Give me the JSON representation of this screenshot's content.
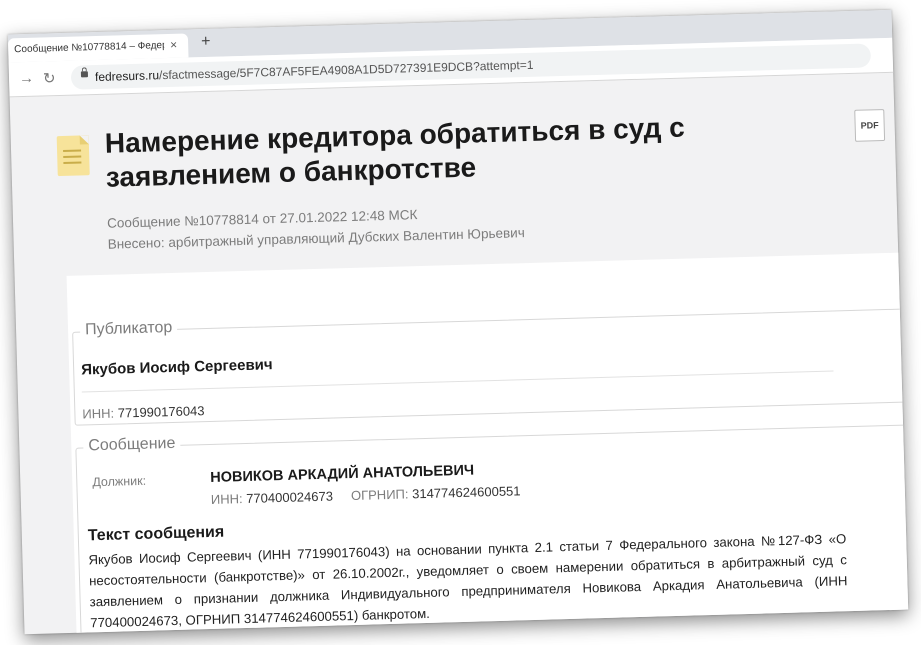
{
  "browser": {
    "tab_title": "Сообщение №10778814 – Федерс",
    "tab_close": "×",
    "new_tab": "+",
    "url_host": "fedresurs.ru",
    "url_path": "/sfactmessage/5F7C87AF5FEA4908A1D5D727391E9DCB?attempt=1",
    "back_icon": "back-arrow-icon",
    "forward_icon": "forward-arrow-icon",
    "reload_icon": "reload-icon"
  },
  "header": {
    "title": "Намерение кредитора обратиться в суд с заявлением о банкротстве",
    "pdf_label": "PDF",
    "meta_line1": "Сообщение №10778814 от 27.01.2022 12:48 МСК",
    "meta_line2": "Внесено: арбитражный управляющий Дубских Валентин Юрьевич"
  },
  "publisher": {
    "legend": "Публикатор",
    "name": "Якубов Иосиф Сергеевич",
    "inn_label": "ИНН:",
    "inn_value": "771990176043"
  },
  "message": {
    "legend": "Сообщение",
    "debtor_label": "Должник:",
    "debtor_name": "НОВИКОВ АРКАДИЙ АНАТОЛЬЕВИЧ",
    "inn_label": "ИНН:",
    "inn_value": "770400024673",
    "ogrnip_label": "ОГРНИП:",
    "ogrnip_value": "314774624600551",
    "text_heading": "Текст сообщения",
    "text_body": "Якубов Иосиф Сергеевич (ИНН 771990176043) на основании пункта 2.1 статьи 7 Федерального закона №127-ФЗ «О несостоятельности (банкротстве)» от 26.10.2002г., уведомляет о своем намерении обратиться в арбитражный суд с заявлением о признании должника Индивидуального предпринимателя Новикова Аркадия Анатольевича (ИНН 770400024673, ОГРНИП 314774624600551) банкротом."
  },
  "colors": {
    "page_bg": "#f2f2f3",
    "muted_text": "#7c7c7c",
    "icon_yellow": "#f7e39a"
  }
}
